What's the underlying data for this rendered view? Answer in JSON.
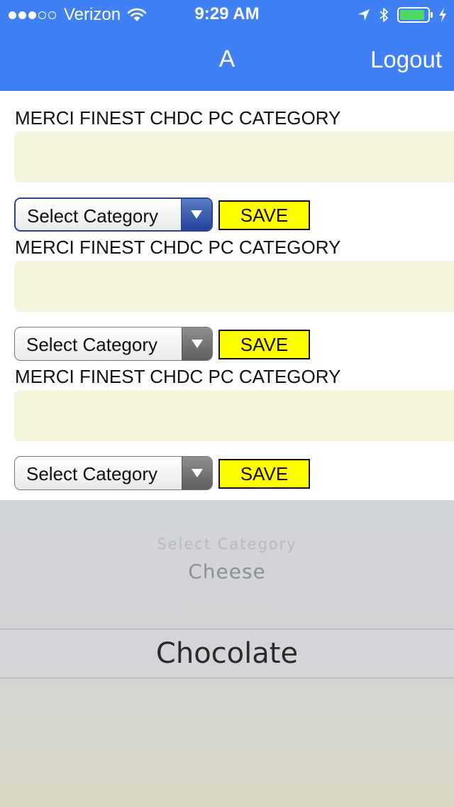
{
  "status_bar": {
    "carrier": "Verizon",
    "time": "9:29 AM",
    "signal_bars_filled": 3,
    "signal_bars_total": 5,
    "battery_level": 0.9,
    "battery_color": "#4cd964"
  },
  "nav": {
    "title": "A",
    "logout_label": "Logout",
    "bar_color": "#3f80f4"
  },
  "blocks": [
    {
      "title": "MERCI FINEST CHDC PC CATEGORY",
      "text_value": "",
      "select_value": "Select Category",
      "save_label": "SAVE"
    },
    {
      "title": "MERCI FINEST CHDC PC CATEGORY",
      "text_value": "",
      "select_value": "Select Category",
      "save_label": "SAVE"
    },
    {
      "title": "MERCI FINEST CHDC PC CATEGORY",
      "text_value": "",
      "select_value": "Select Category",
      "save_label": "SAVE"
    }
  ],
  "picker": {
    "options": [
      "Select Category",
      "Cheese",
      "Chocolate"
    ],
    "selected": "Chocolate"
  },
  "colors": {
    "text_area_bg": "#f5f5dc",
    "save_button_bg": "#ffff00"
  },
  "icons": [
    "signal-dots-icon",
    "wifi-icon",
    "location-arrow-icon",
    "bluetooth-icon",
    "battery-icon",
    "charging-bolt-icon",
    "chevron-down-icon"
  ]
}
